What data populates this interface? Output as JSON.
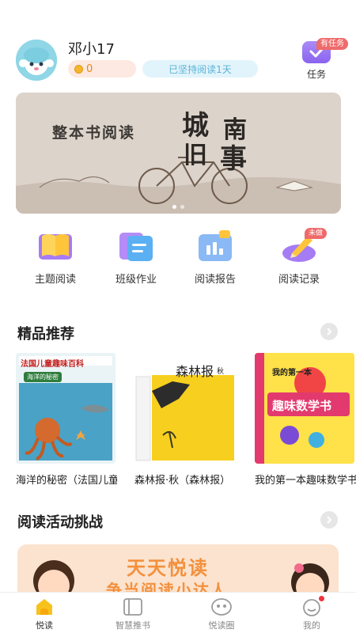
{
  "header": {
    "username": "邓小17",
    "coins": "0",
    "streak": "已坚持阅读1天",
    "task_badge": "有任务",
    "task_label": "任务"
  },
  "banner": {
    "title": "整本书阅读",
    "big_chars": [
      "城",
      "南",
      "旧",
      "事"
    ],
    "slides": 2,
    "active_slide": 0
  },
  "features": [
    {
      "label": "主题阅读",
      "icon": "book-icon"
    },
    {
      "label": "班级作业",
      "icon": "homework-icon"
    },
    {
      "label": "阅读报告",
      "icon": "report-icon"
    },
    {
      "label": "阅读记录",
      "icon": "record-icon",
      "badge": "未做"
    }
  ],
  "recommend": {
    "title": "精品推荐",
    "books": [
      {
        "title": "海洋的秘密（法国儿童趣味百科）",
        "cover_text": "法国儿童趣味百科",
        "cover_sub": "海洋的秘密"
      },
      {
        "title": "森林报·秋（森林报）",
        "cover_text": "森林报",
        "cover_sub": "秋"
      },
      {
        "title": "我的第一本趣味数学书",
        "cover_text": "我的第一本",
        "cover_sub": "趣味数学书"
      }
    ]
  },
  "challenge": {
    "title": "阅读活动挑战",
    "banner_line1": "天天悦读",
    "banner_line2": "争当阅读小达人"
  },
  "tabbar": [
    {
      "label": "悦读",
      "icon": "home-icon",
      "active": true
    },
    {
      "label": "智慧推书",
      "icon": "smart-book-icon",
      "active": false
    },
    {
      "label": "悦读圈",
      "icon": "circle-icon",
      "active": false
    },
    {
      "label": "我的",
      "icon": "profile-icon",
      "active": false,
      "dot": true
    }
  ],
  "colors": {
    "accent_purple": "#8a63ef",
    "badge_red": "#ef6a6a",
    "coin_orange": "#e28a1a",
    "streak_blue": "#5ab3d6",
    "tab_yellow": "#f8c21c"
  }
}
